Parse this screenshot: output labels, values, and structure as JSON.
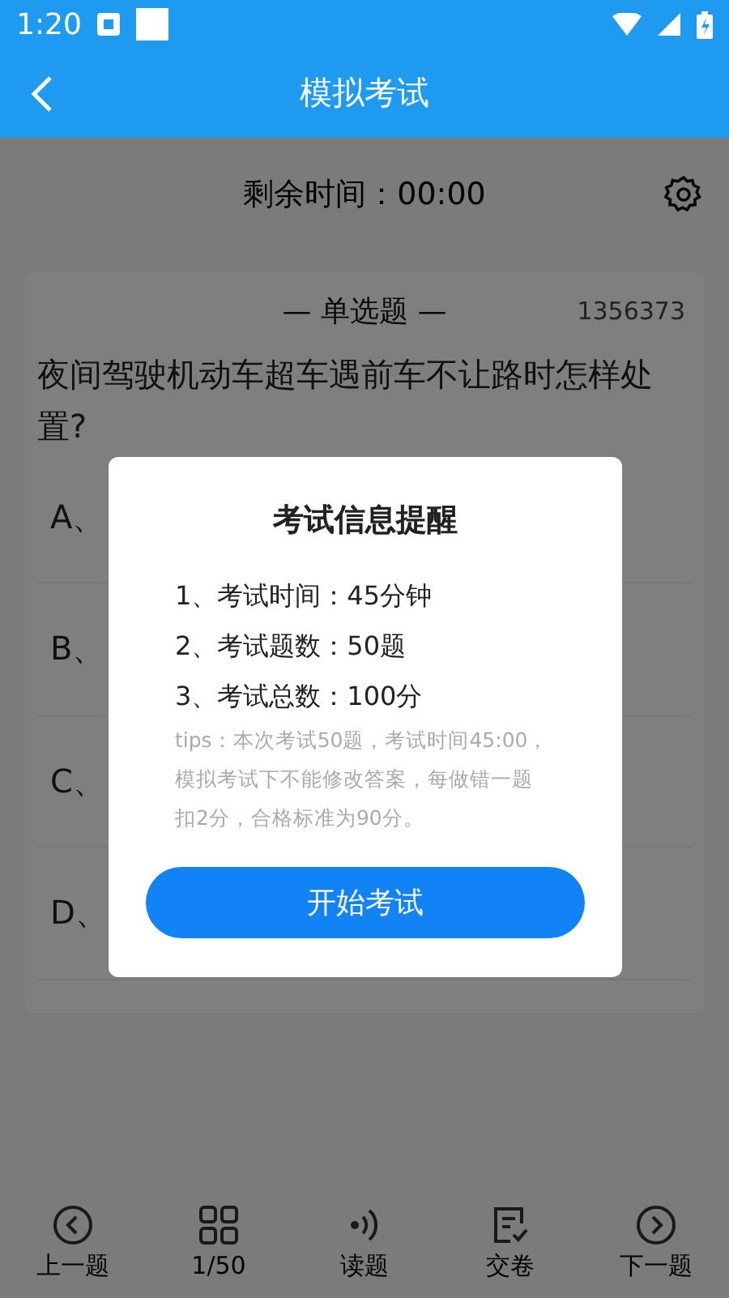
{
  "status_bar": {
    "time": "1:20"
  },
  "header": {
    "title": "模拟考试"
  },
  "timer": {
    "label": "剩余时间：00:00"
  },
  "question": {
    "type_label": "— 单选题 —",
    "id": "1356373",
    "text": "夜间驾驶机动车超车遇前车不让路时怎样处置?",
    "options": [
      {
        "label": "A、"
      },
      {
        "label": "B、"
      },
      {
        "label": "C、"
      },
      {
        "label": "D、"
      }
    ]
  },
  "dialog": {
    "title": "考试信息提醒",
    "items": [
      "1、考试时间：45分钟",
      "2、考试题数：50题",
      "3、考试总数：100分"
    ],
    "tips": "tips：本次考试50题，考试时间45:00，模拟考试下不能修改答案，每做错一题扣2分，合格标准为90分。",
    "button": "开始考试"
  },
  "bottom_nav": [
    {
      "kind": "prev",
      "label": "上一题"
    },
    {
      "kind": "grid",
      "label": "1/50"
    },
    {
      "kind": "read",
      "label": "读题"
    },
    {
      "kind": "submit",
      "label": "交卷"
    },
    {
      "kind": "next",
      "label": "下一题"
    }
  ]
}
